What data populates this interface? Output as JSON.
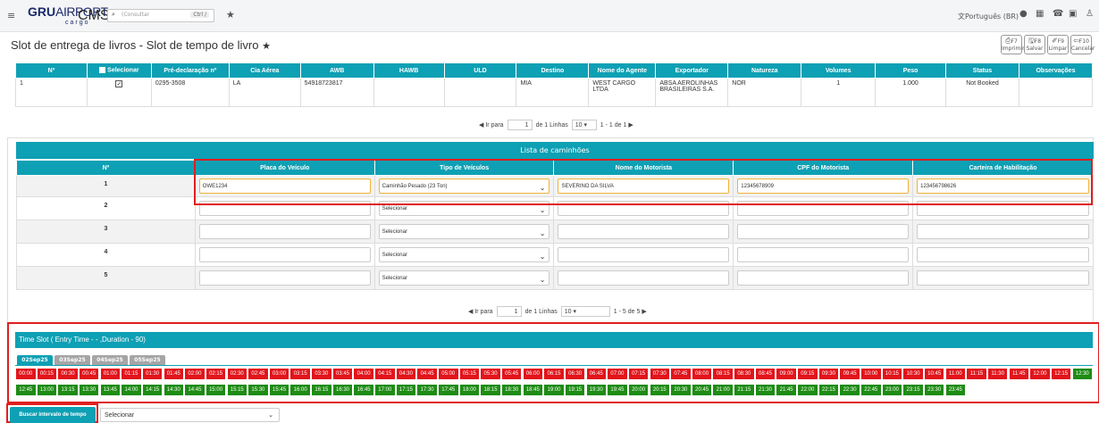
{
  "app": {
    "logo_main": "GRU",
    "logo_sub": "AIRPORT",
    "logo_cargo": "cargo",
    "name": "CMS+",
    "search_placeholder": "(Consultar",
    "search_shortcut": "Ctrl /",
    "language": "Português (BR)"
  },
  "page": {
    "title": "Slot de entrega de livros - Slot de tempo de livro"
  },
  "header_buttons": [
    {
      "key": "F7",
      "label": "Imprimir"
    },
    {
      "key": "F8",
      "label": "Salvar"
    },
    {
      "key": "F9",
      "label": "Limpar"
    },
    {
      "key": "F10",
      "label": "Cancelar"
    }
  ],
  "top_table": {
    "columns": [
      "Nº",
      "Selecionar",
      "Pré-declaração nº",
      "Cia Aérea",
      "AWB",
      "HAWB",
      "ULD",
      "Destino",
      "Nome do Agente",
      "Exportador",
      "Natureza",
      "Volumes",
      "Peso",
      "Status",
      "Observações"
    ],
    "row": {
      "n": "1",
      "checked": "✓",
      "pre": "0295-3508",
      "cia": "LA",
      "awb": "54918723817",
      "hawb": "",
      "uld": "",
      "destino": "MIA",
      "agente": "WEST CARGO LTDA",
      "exportador": "ABSA AEROLINHAS BRASILEIRAS S.A.",
      "natureza": "NOR",
      "volumes": "1",
      "peso": "1.000",
      "status": "Not Booked",
      "obs": ""
    }
  },
  "pager1": {
    "goto": "Ir para",
    "page": "1",
    "of": "de 1 Linhas",
    "rows": "10",
    "range": "1 - 1 de 1"
  },
  "trucks": {
    "header": "Lista de caminhões",
    "columns": [
      "Nº",
      "Placa do Veículo",
      "Tipo de Veículos",
      "Nome do Motorista",
      "CPF do Motorista",
      "Carteira de Habilitação"
    ],
    "rows": [
      {
        "n": "1",
        "placa": "OWE1234",
        "tipo": "Caminhão Pesado (23 Ton)",
        "motorista": "SEVERINO DA SILVA",
        "cpf": "12345678909",
        "cnh": "123456798626"
      },
      {
        "n": "2",
        "placa": "",
        "tipo": "Selecionar",
        "motorista": "",
        "cpf": "",
        "cnh": ""
      },
      {
        "n": "3",
        "placa": "",
        "tipo": "Selecionar",
        "motorista": "",
        "cpf": "",
        "cnh": ""
      },
      {
        "n": "4",
        "placa": "",
        "tipo": "Selecionar",
        "motorista": "",
        "cpf": "",
        "cnh": ""
      },
      {
        "n": "5",
        "placa": "",
        "tipo": "Selecionar",
        "motorista": "",
        "cpf": "",
        "cnh": ""
      }
    ]
  },
  "pager2": {
    "goto": "Ir para",
    "page": "1",
    "of": "de 1 Linhas",
    "rows": "10",
    "range": "1 - 5 de 5"
  },
  "timeslot": {
    "header": "Time Slot ( Entry Time - - ,Duration - 90)",
    "dates": [
      "02Sep25",
      "03Sep25",
      "04Sep25",
      "05Sep25"
    ],
    "slots": [
      "00:00",
      "00:15",
      "00:30",
      "00:45",
      "01:00",
      "01:15",
      "01:30",
      "01:45",
      "02:00",
      "02:15",
      "02:30",
      "02:45",
      "03:00",
      "03:15",
      "03:30",
      "03:45",
      "04:00",
      "04:15",
      "04:30",
      "04:45",
      "05:00",
      "05:15",
      "05:30",
      "05:45",
      "06:00",
      "06:15",
      "06:30",
      "06:45",
      "07:00",
      "07:15",
      "07:30",
      "07:45",
      "08:00",
      "08:15",
      "08:30",
      "08:45",
      "09:00",
      "09:15",
      "09:30",
      "09:45",
      "10:00",
      "10:15",
      "10:30",
      "10:45",
      "11:00",
      "11:15",
      "11:30",
      "11:45",
      "12:00",
      "12:15",
      "12:30",
      "12:45",
      "13:00",
      "13:15",
      "13:30",
      "13:45",
      "14:00",
      "14:15",
      "14:30",
      "14:45",
      "15:00",
      "15:15",
      "15:30",
      "15:45",
      "16:00",
      "16:15",
      "16:30",
      "16:45",
      "17:00",
      "17:15",
      "17:30",
      "17:45",
      "18:00",
      "18:15",
      "18:30",
      "18:45",
      "19:00",
      "19:15",
      "19:30",
      "19:45",
      "20:00",
      "20:15",
      "20:30",
      "20:45",
      "21:00",
      "21:15",
      "21:30",
      "21:45",
      "22:00",
      "22:15",
      "22:30",
      "22:45",
      "23:00",
      "23:15",
      "23:30",
      "23:45"
    ],
    "available_from": "12:30"
  },
  "bottom": {
    "button": "Buscar intervalo de tempo",
    "select": "Selecionar"
  }
}
